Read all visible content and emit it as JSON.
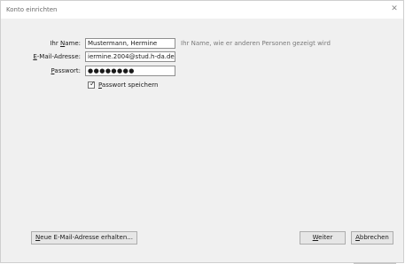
{
  "window": {
    "title": "Konto einrichten",
    "close_icon": "close-icon"
  },
  "form": {
    "name_label_pre": "Ihr ",
    "name_label_key": "N",
    "name_label_post": "ame:",
    "name_value": "Mustermann, Hermine",
    "name_hint": "Ihr Name, wie er anderen Personen gezeigt wird",
    "email_label_key": "E",
    "email_label_post": "-Mail-Adresse:",
    "email_value": "iermine.2004@stud.h-da.de",
    "password_label_key": "P",
    "password_label_post": "asswort:",
    "password_value": "●●●●●●●●",
    "remember_key": "P",
    "remember_post": "asswort speichern",
    "remember_checked": true
  },
  "buttons": {
    "new_address_key": "N",
    "new_address_post": "eue E-Mail-Adresse erhalten...",
    "next_key": "W",
    "next_post": "eiter",
    "cancel_key": "A",
    "cancel_post": "bbrechen"
  },
  "colors": {
    "dialog_bg": "#f0f0f0",
    "input_border": "#8f8f8f",
    "hint_text": "#7a7a7a"
  }
}
